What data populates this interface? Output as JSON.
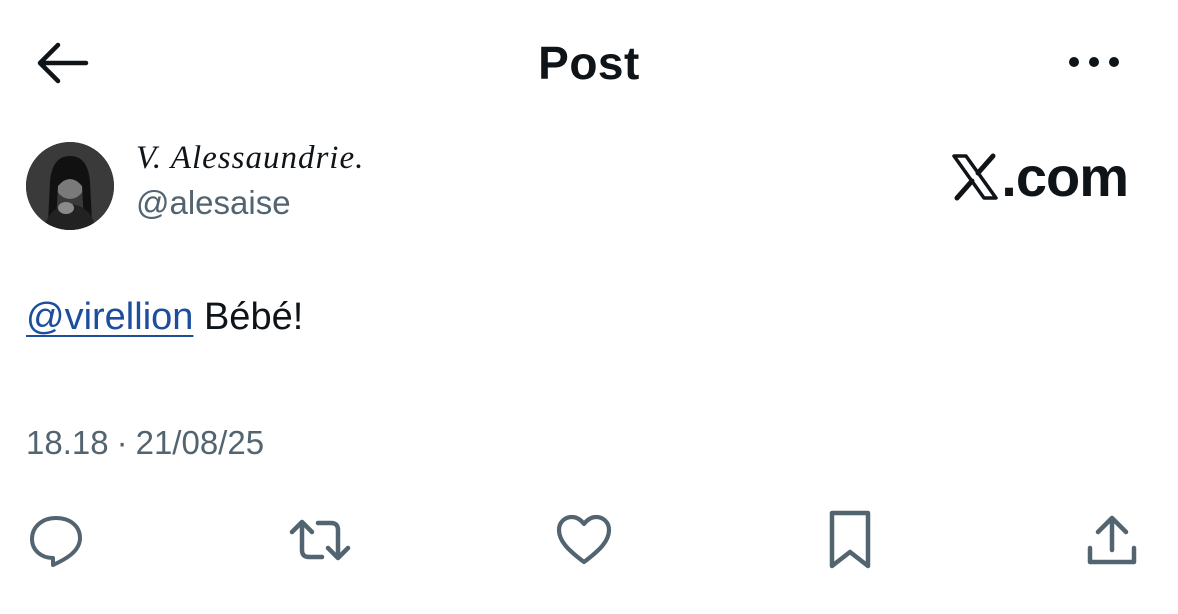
{
  "header": {
    "title": "Post",
    "back_icon": "arrow-left-icon",
    "more_icon": "more-horizontal-icon"
  },
  "author": {
    "display_name": "V. Alessaundrie.",
    "handle": "@alesaise",
    "avatar_icon": "avatar"
  },
  "watermark": {
    "text": ".com",
    "icon": "x-logo-icon"
  },
  "tweet": {
    "mention": "@virellion",
    "text": " Bébé!"
  },
  "meta": {
    "time": "18.18",
    "separator": "·",
    "date": "21/08/25"
  },
  "actions": {
    "reply_icon": "reply-icon",
    "repost_icon": "repost-icon",
    "like_icon": "heart-icon",
    "bookmark_icon": "bookmark-icon",
    "share_icon": "share-icon"
  },
  "colors": {
    "text": "#0f1419",
    "secondary": "#536471",
    "mention": "#1d4e9e",
    "background": "#ffffff"
  }
}
